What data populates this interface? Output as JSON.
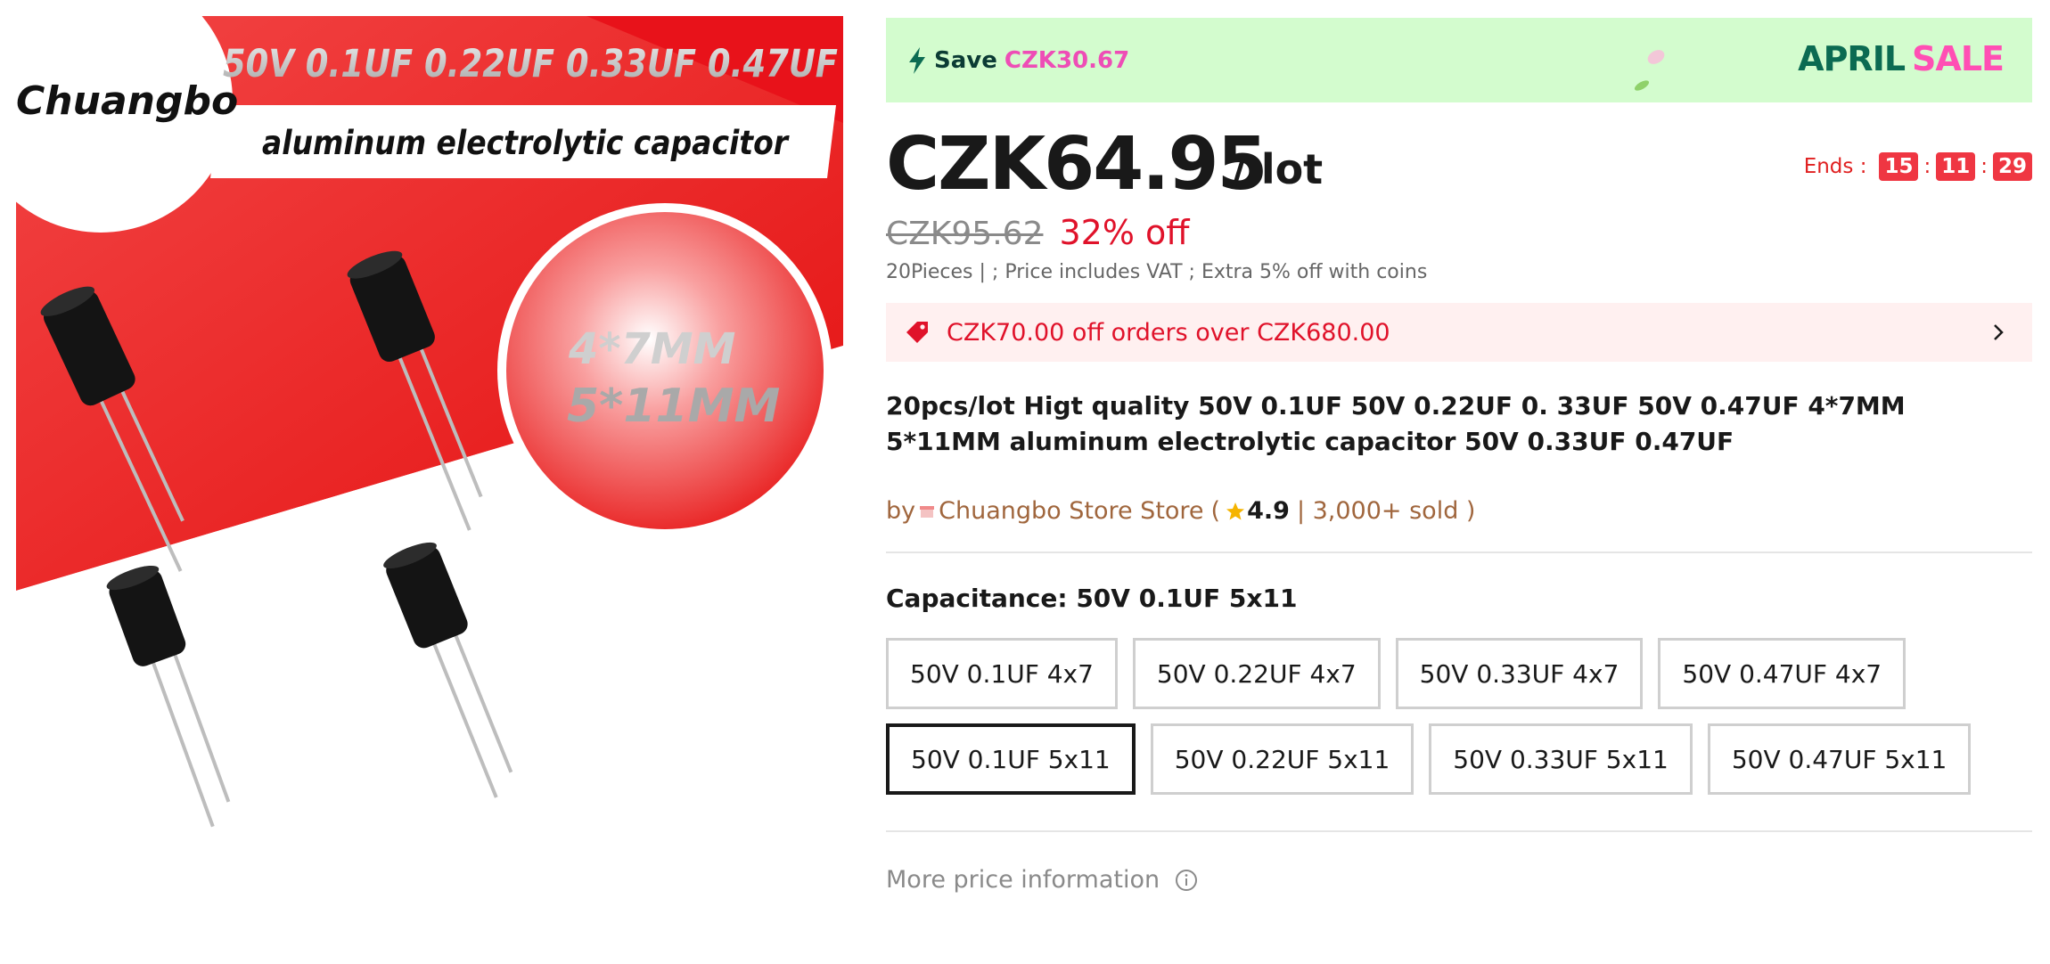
{
  "product_image": {
    "brand": "Chuangbo",
    "spec_headline": "50V 0.1UF 0.22UF 0.33UF 0.47UF",
    "subtitle": "aluminum electrolytic capacitor",
    "size_line1": "4*7MM",
    "size_line2": "5*11MM",
    "accent_color": "#f02020"
  },
  "banner": {
    "icon": "lightning-icon",
    "save_label": "Save",
    "save_amount": "CZK30.67",
    "promo_word1": "APRIL",
    "promo_word2": "SALE",
    "bg_color": "#d3fcce"
  },
  "price": {
    "current": "CZK64.95",
    "unit": "/ lot",
    "original": "CZK95.62",
    "discount": "32% off"
  },
  "countdown": {
    "label": "Ends :",
    "hours": "15",
    "minutes": "11",
    "seconds": "29",
    "separator": ":"
  },
  "vat_note": "20Pieces | ; Price includes VAT ; Extra 5% off with coins",
  "coupon": {
    "icon": "tag-icon",
    "text": "CZK70.00 off orders over CZK680.00"
  },
  "title": "20pcs/lot Higt quality 50V 0.1UF 50V 0.22UF 0. 33UF 50V 0.47UF 4*7MM 5*11MM aluminum electrolytic capacitor 50V 0.33UF 0.47UF",
  "store": {
    "by": "by",
    "name": "Chuangbo Store Store",
    "open_paren": "(",
    "rating": "4.9",
    "sold": "| 3,000+ sold )"
  },
  "capacitance": {
    "label": "Capacitance: 50V 0.1UF 5x11",
    "row1": [
      "50V 0.1UF 4x7",
      "50V 0.22UF 4x7",
      "50V 0.33UF 4x7",
      "50V 0.47UF 4x7"
    ],
    "row2": [
      "50V 0.1UF 5x11",
      "50V 0.22UF 5x11",
      "50V 0.33UF 5x11",
      "50V 0.47UF 5x11"
    ],
    "selected": "50V 0.1UF 5x11"
  },
  "more_price_info": "More price information"
}
